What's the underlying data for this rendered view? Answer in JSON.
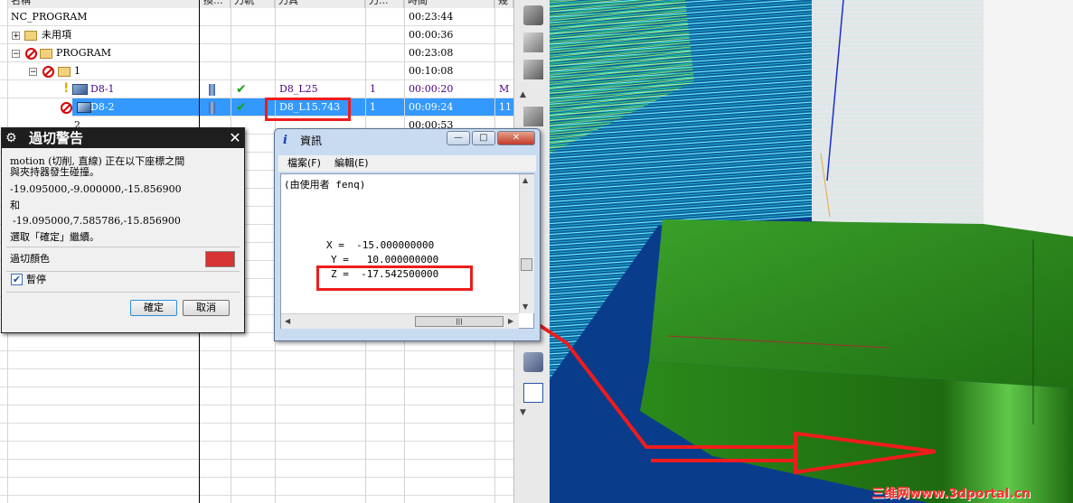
{
  "navigator": {
    "columns": [
      "名稱",
      "換...",
      "刀軌",
      "刀具",
      "刀...",
      "時間",
      "幾"
    ],
    "rows": [
      {
        "name": "NC_PROGRAM",
        "time": "00:23:44"
      },
      {
        "name": "未用項",
        "time": "00:00:36"
      },
      {
        "name": "PROGRAM",
        "time": "00:23:08"
      },
      {
        "name": "1",
        "time": "00:10:08"
      },
      {
        "name": "D8-1",
        "tool": "D8_L25",
        "tool_no": "1",
        "time": "00:00:20",
        "geom": "M"
      },
      {
        "name": "D8-2",
        "tool": "D8_L15.743",
        "tool_no": "1",
        "time": "00:09:24",
        "geom": "11"
      },
      {
        "name": "2",
        "time": "00:00:53"
      }
    ]
  },
  "overcut_dialog": {
    "title": "過切警告",
    "line1": "motion (切削, 直線) 正在以下座標之間",
    "line2": "與夾持器發生碰撞。",
    "coord1": "-19.095000,-9.000000,-15.856900",
    "and": "和",
    "coord2": "-19.095000,7.585786,-15.856900",
    "continue": "選取「確定」繼續。",
    "color_label": "過切顏色",
    "overcut_color": "#d63333",
    "pause_label": "暫停",
    "pause_checked": true,
    "ok": "確定",
    "cancel": "取消"
  },
  "info_window": {
    "title": "資訊",
    "menu_file": "檔案(F)",
    "menu_edit": "編輯(E)",
    "header_line": "(由使用者 fenq)",
    "x_line": "X =  -15.000000000",
    "y_line": "Y =   10.000000000",
    "z_line": "Z =  -17.542500000"
  },
  "watermark": "三维网www.3dportal.cn",
  "colors": {
    "selection": "#3399ff",
    "viewport_bg": "#0a3c8c",
    "part_green": "#2f8a1c",
    "highlight_red": "#ee1c1c"
  }
}
